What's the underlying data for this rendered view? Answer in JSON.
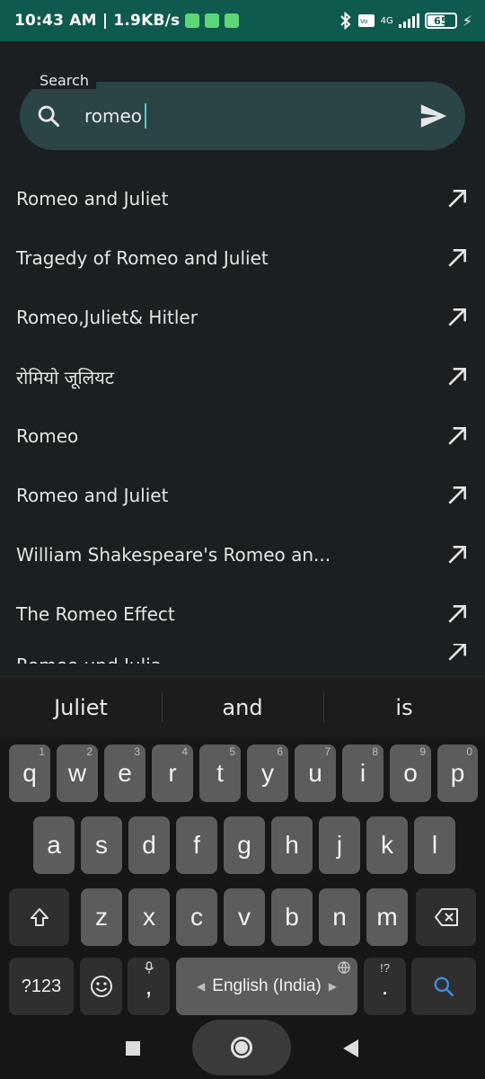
{
  "status_bar": {
    "time_speed": "10:43 AM | 1.9KB/s",
    "network_label": "4G",
    "battery": "65"
  },
  "search": {
    "label": "Search",
    "query": "romeo"
  },
  "suggestions": [
    "Romeo and Juliet",
    "Tragedy of Romeo and Juliet",
    "Romeo,Juliet& Hitler",
    "रोमियो जूलियट",
    "Romeo",
    "Romeo and Juliet",
    "William Shakespeare's Romeo an...",
    "The Romeo Effect",
    "Romeo und Julia"
  ],
  "keyboard": {
    "word_suggestions": [
      "Juliet",
      "and",
      "is"
    ],
    "row1": [
      "q",
      "w",
      "e",
      "r",
      "t",
      "y",
      "u",
      "i",
      "o",
      "p"
    ],
    "row1_hints": [
      "1",
      "2",
      "3",
      "4",
      "5",
      "6",
      "7",
      "8",
      "9",
      "0"
    ],
    "row2": [
      "a",
      "s",
      "d",
      "f",
      "g",
      "h",
      "j",
      "k",
      "l"
    ],
    "row3": [
      "z",
      "x",
      "c",
      "v",
      "b",
      "n",
      "m"
    ],
    "symbols_key": "?123",
    "comma_key": ",",
    "space_label": "English (India)",
    "period_key": ".",
    "period_hint": "!?"
  },
  "icons": {
    "search": "search-icon",
    "send": "send-icon",
    "suggestion_arrow": "arrow-up-left-icon"
  }
}
